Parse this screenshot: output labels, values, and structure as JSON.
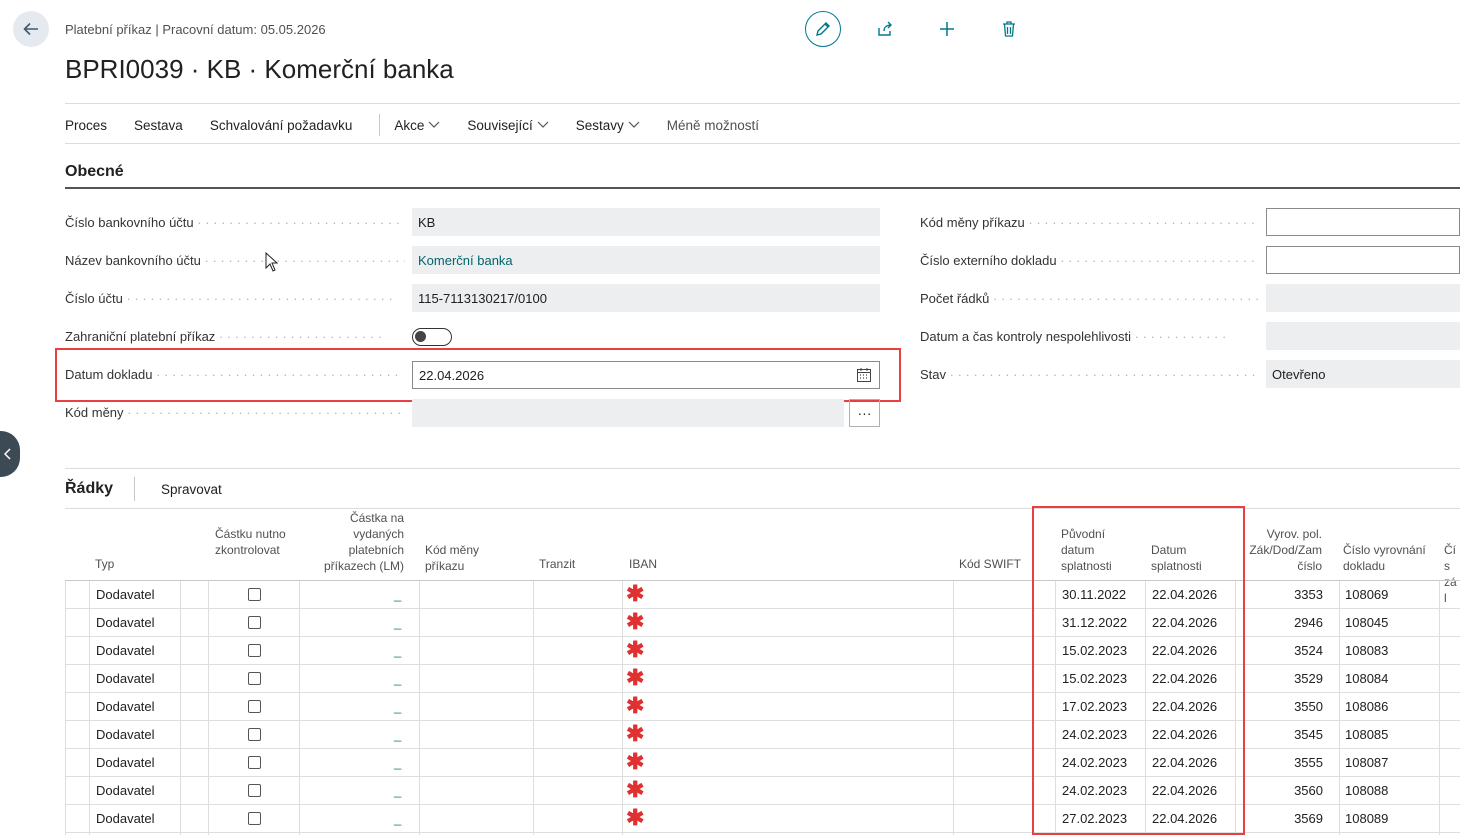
{
  "header": {
    "breadcrumb": "Platební příkaz | Pracovní datum: 05.05.2026",
    "title": "BPRI0039 · KB · Komerční banka"
  },
  "menu": {
    "items": [
      "Proces",
      "Sestava",
      "Schvalování požadavku"
    ],
    "dropdowns": [
      "Akce",
      "Související",
      "Sestavy"
    ],
    "less": "Méně možností"
  },
  "general": {
    "section_title": "Obecné",
    "left_fields": [
      {
        "label": "Číslo bankovního účtu",
        "value": "KB"
      },
      {
        "label": "Název bankovního účtu",
        "value": "Komerční banka"
      },
      {
        "label": "Číslo účtu",
        "value": "115-7113130217/0100"
      },
      {
        "label": "Zahraniční platební příkaz",
        "value": ""
      },
      {
        "label": "Datum dokladu",
        "value": "22.04.2026"
      },
      {
        "label": "Kód měny",
        "value": ""
      }
    ],
    "right_fields": [
      {
        "label": "Kód měny příkazu",
        "value": ""
      },
      {
        "label": "Číslo externího dokladu",
        "value": ""
      },
      {
        "label": "Počet řádků",
        "value": ""
      },
      {
        "label": "Datum a čas kontroly nespolehlivosti",
        "value": ""
      },
      {
        "label": "Stav",
        "value": "Otevřeno"
      }
    ],
    "ellipsis": "···"
  },
  "lines": {
    "title": "Řádky",
    "manage": "Spravovat",
    "columns": {
      "typ": "Typ",
      "castku": "Částku nutno zkontrolovat",
      "castka_lm": "Částka na vydaných platebních příkazech (LM)",
      "kod_meny": "Kód měny příkazu",
      "tranzit": "Tranzit",
      "iban": "IBAN",
      "swift": "Kód SWIFT",
      "puvodni": "Původní datum splatnosti",
      "datum": "Datum splatnosti",
      "vyrov": "Vyrov. pol. Zák/Dod/Zam číslo",
      "cislo_vyr": "Číslo vyrovnání dokladu",
      "cis_zal": "Čís zál"
    },
    "rows": [
      {
        "typ": "Dodavatel",
        "dash": "_",
        "req": "✱",
        "puvodni": "30.11.2022",
        "datum": "22.04.2026",
        "vyrov": "3353",
        "cislo": "108069"
      },
      {
        "typ": "Dodavatel",
        "dash": "_",
        "req": "✱",
        "puvodni": "31.12.2022",
        "datum": "22.04.2026",
        "vyrov": "2946",
        "cislo": "108045"
      },
      {
        "typ": "Dodavatel",
        "dash": "_",
        "req": "✱",
        "puvodni": "15.02.2023",
        "datum": "22.04.2026",
        "vyrov": "3524",
        "cislo": "108083"
      },
      {
        "typ": "Dodavatel",
        "dash": "_",
        "req": "✱",
        "puvodni": "15.02.2023",
        "datum": "22.04.2026",
        "vyrov": "3529",
        "cislo": "108084"
      },
      {
        "typ": "Dodavatel",
        "dash": "_",
        "req": "✱",
        "puvodni": "17.02.2023",
        "datum": "22.04.2026",
        "vyrov": "3550",
        "cislo": "108086"
      },
      {
        "typ": "Dodavatel",
        "dash": "_",
        "req": "✱",
        "puvodni": "24.02.2023",
        "datum": "22.04.2026",
        "vyrov": "3545",
        "cislo": "108085"
      },
      {
        "typ": "Dodavatel",
        "dash": "_",
        "req": "✱",
        "puvodni": "24.02.2023",
        "datum": "22.04.2026",
        "vyrov": "3555",
        "cislo": "108087"
      },
      {
        "typ": "Dodavatel",
        "dash": "_",
        "req": "✱",
        "puvodni": "24.02.2023",
        "datum": "22.04.2026",
        "vyrov": "3560",
        "cislo": "108088"
      },
      {
        "typ": "Dodavatel",
        "dash": "_",
        "req": "✱",
        "puvodni": "27.02.2023",
        "datum": "22.04.2026",
        "vyrov": "3569",
        "cislo": "108089"
      }
    ]
  },
  "colors": {
    "accent": "#00788c",
    "highlight": "#e84040",
    "required": "#e03030"
  }
}
